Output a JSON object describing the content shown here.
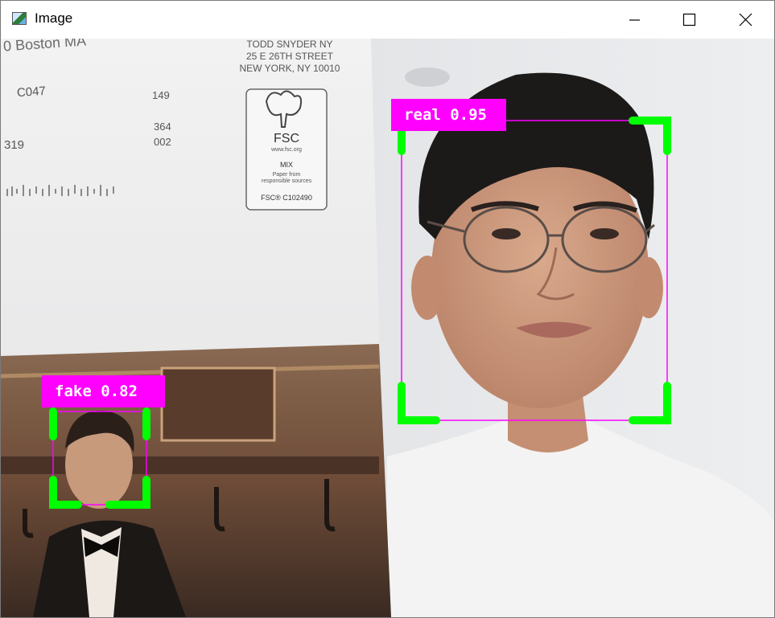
{
  "window": {
    "title": "Image",
    "icon": "image-window-icon",
    "controls": [
      "minimize-icon",
      "maximize-icon",
      "close-icon"
    ]
  },
  "detections": [
    {
      "label": "real 0.95"
    },
    {
      "label": "fake 0.82"
    }
  ],
  "colors": {
    "box_outline": "#ff00ff",
    "corner_brackets": "#00ff00",
    "label_background": "#ff00ff",
    "label_text": "#ffffff"
  },
  "photo_text": {
    "address": [
      "TODD SNYDER NY",
      "25 E 26TH STREET",
      "NEW YORK, NY 10010"
    ],
    "partial_top": "0 Boston MA",
    "code1": "C047",
    "num1": "149",
    "num2": "364",
    "num3": "002",
    "num4": "319",
    "fsc_title": "FSC",
    "fsc_url": "www.fsc.org",
    "fsc_mix": "MIX",
    "fsc_paper": "Paper from responsible sources",
    "fsc_code": "FSC® C102490"
  }
}
